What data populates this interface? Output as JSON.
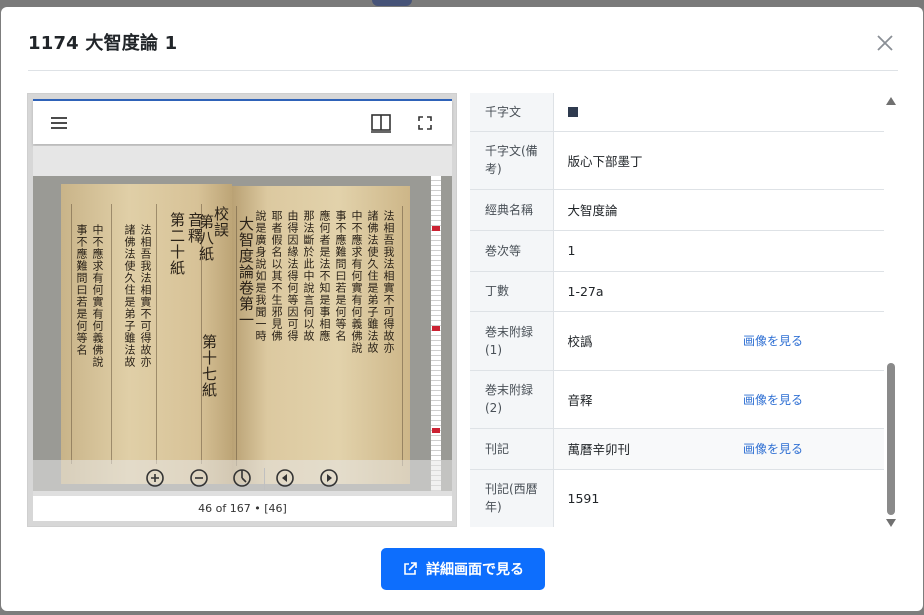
{
  "modal": {
    "title": "1174 大智度論 1",
    "close_icon": "close-icon"
  },
  "viewer": {
    "caption": "46 of 167 • [46]",
    "icons": {
      "menu": "menu-icon",
      "two_page": "book-open-icon",
      "fullscreen": "fullscreen-icon",
      "zoom_in": "zoom-in-icon",
      "zoom_out": "zoom-out-icon",
      "rotate": "rotate-icon",
      "prev": "chevron-left-icon",
      "next": "chevron-right-icon"
    },
    "scan_text": {
      "left_cols": [
        "音釋",
        "第二十紙",
        "校誤",
        "第八紙",
        "第十七紙"
      ],
      "right_cols": [
        "大智度論卷第一",
        "法相吾我法相實不可得故亦",
        "諸佛法使久住是弟子雖法故",
        "中不應求有何實有何義佛說",
        "事不應難問曰若是何等名",
        "應何者是法不知是事相應",
        "那法斷於此中說言何以故",
        "由得因緣法得何等因可得",
        "耶者假名以其不生邪見佛",
        "說是廣身說如是我聞一時"
      ]
    }
  },
  "metadata": {
    "rows": [
      {
        "key": "千字文",
        "value": "■",
        "link": ""
      },
      {
        "key": "千字文(備考)",
        "value": "版心下部墨丁",
        "link": ""
      },
      {
        "key": "經典名稱",
        "value": "大智度論",
        "link": ""
      },
      {
        "key": "巻次等",
        "value": "1",
        "link": ""
      },
      {
        "key": "丁數",
        "value": "1-27a",
        "link": ""
      },
      {
        "key": "巻末附録(1)",
        "value": "校譌",
        "link": "画像を見る"
      },
      {
        "key": "巻末附録(2)",
        "value": "音释",
        "link": "画像を見る"
      },
      {
        "key": "刊記",
        "value": "萬曆辛卯刊",
        "link": "画像を見る"
      },
      {
        "key": "刊記(西暦年)",
        "value": "1591",
        "link": ""
      }
    ]
  },
  "footer": {
    "detail_button": "詳細画面で見る",
    "detail_icon": "external-link-icon"
  },
  "colors": {
    "accent": "#0d6efd",
    "link": "#2e6fd3",
    "viewer_border": "#2e62b8"
  }
}
